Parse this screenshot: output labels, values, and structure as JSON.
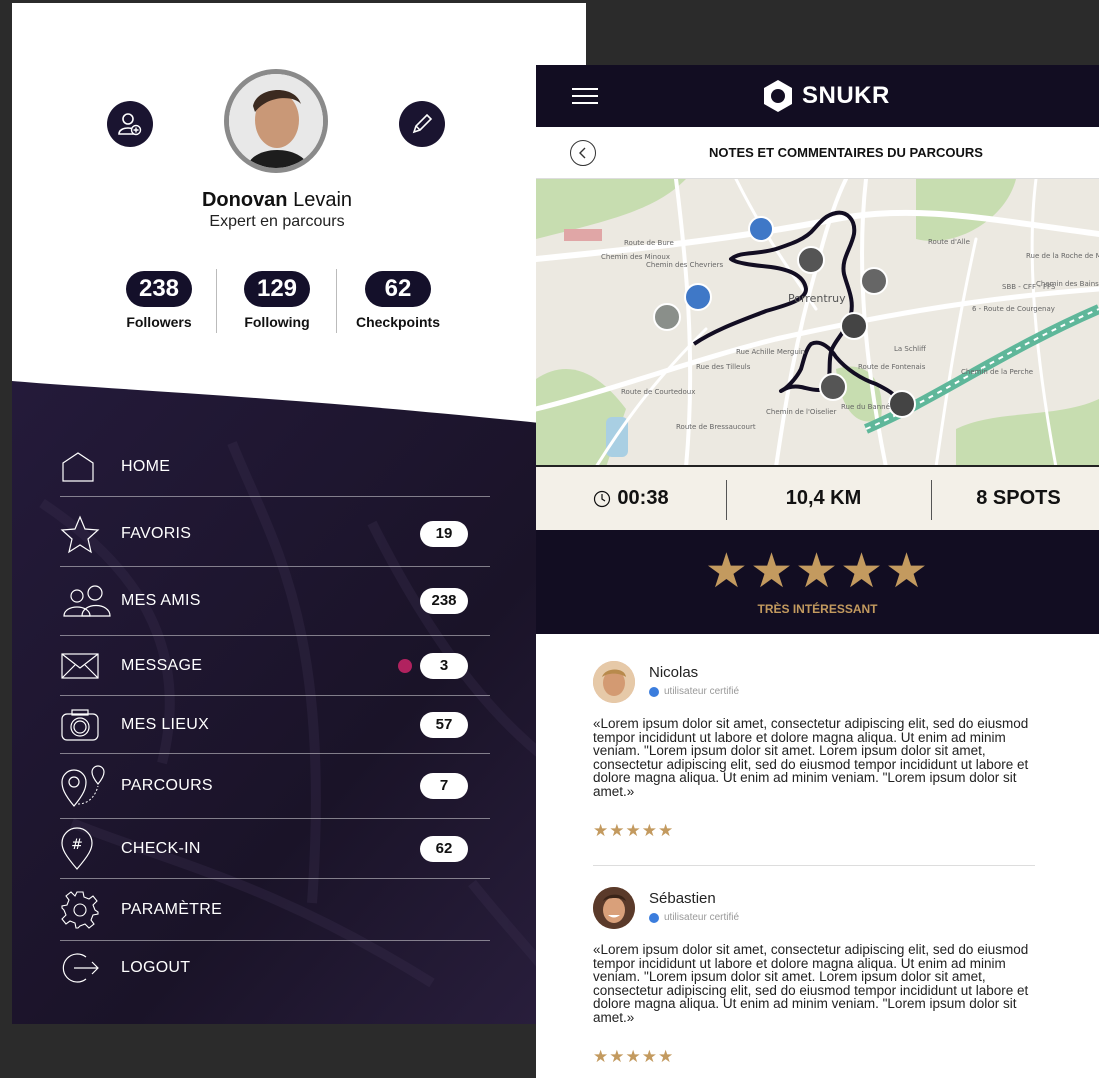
{
  "profile": {
    "first_name": "Donovan",
    "last_name": "Levain",
    "role": "Expert en parcours",
    "stats": [
      {
        "value": "238",
        "label": "Followers"
      },
      {
        "value": "129",
        "label": "Following"
      },
      {
        "value": "62",
        "label": "Checkpoints"
      }
    ]
  },
  "menu": {
    "items": [
      {
        "label": "HOME",
        "icon": "home-icon",
        "badge": ""
      },
      {
        "label": "FAVORIS",
        "icon": "star-icon",
        "badge": "19"
      },
      {
        "label": "MES AMIS",
        "icon": "friends-icon",
        "badge": "238"
      },
      {
        "label": "MESSAGE",
        "icon": "envelope-icon",
        "badge": "3"
      },
      {
        "label": "MES LIEUX",
        "icon": "camera-icon",
        "badge": "57"
      },
      {
        "label": "PARCOURS",
        "icon": "route-pins-icon",
        "badge": "7"
      },
      {
        "label": "CHECK-IN",
        "icon": "hashtag-pin-icon",
        "badge": "62"
      },
      {
        "label": "PARAMÈTRE",
        "icon": "gear-icon",
        "badge": ""
      },
      {
        "label": "LOGOUT",
        "icon": "logout-icon",
        "badge": ""
      }
    ],
    "message_dot_color": "#b1225f"
  },
  "app": {
    "brand": "SNUKR",
    "page_title": "NOTES ET COMMENTAIRES DU PARCOURS"
  },
  "map": {
    "labels": [
      "Porrentruy",
      "Route de Bure",
      "Chemin des Minoux",
      "Chemin des Chevriers",
      "Rue Achille Merguin",
      "Rue des Tilleuls",
      "Route de Courtedoux",
      "Route de Bressaucourt",
      "La Schliff",
      "Chemin de la Perche",
      "Route d'Alle",
      "Rue de la Roche de Mai",
      "SBB - CFF - FFS",
      "6 - Route de Courgenay",
      "Chemin des Bains",
      "Chemin de l'Oiselier",
      "Rue du Banné",
      "Route de Fontenais"
    ]
  },
  "route_stats": {
    "duration": "00:38",
    "distance": "10,4 KM",
    "spots": "8 SPOTS"
  },
  "rating": {
    "stars": "★★★★★",
    "label": "TRÈS INTÉRESSANT"
  },
  "comments": [
    {
      "name": "Nicolas",
      "certified": "utilisateur certifié",
      "text": "«Lorem ipsum dolor sit amet, consectetur adipiscing elit, sed do eiusmod tempor incididunt ut labore et dolore magna aliqua. Ut enim ad minim veniam. \"Lorem ipsum dolor sit amet. Lorem ipsum dolor sit amet, consectetur adipiscing elit, sed do eiusmod tempor incididunt ut labore et dolore magna aliqua. Ut enim ad minim veniam. \"Lorem ipsum dolor sit amet.»",
      "stars": "★★★★★"
    },
    {
      "name": "Sébastien",
      "certified": "utilisateur certifié",
      "text": "«Lorem ipsum dolor sit amet, consectetur adipiscing elit, sed do eiusmod tempor incididunt ut labore et dolore magna aliqua. Ut enim ad minim veniam. \"Lorem ipsum dolor sit amet. Lorem ipsum dolor sit amet, consectetur adipiscing elit, sed do eiusmod tempor incididunt ut labore et dolore magna aliqua. Ut enim ad minim veniam. \"Lorem ipsum dolor sit amet.»",
      "stars": "★★★★★"
    }
  ],
  "colors": {
    "dark": "#120d22",
    "gold": "#c39a5f",
    "certified_blue": "#3b7ddd"
  }
}
